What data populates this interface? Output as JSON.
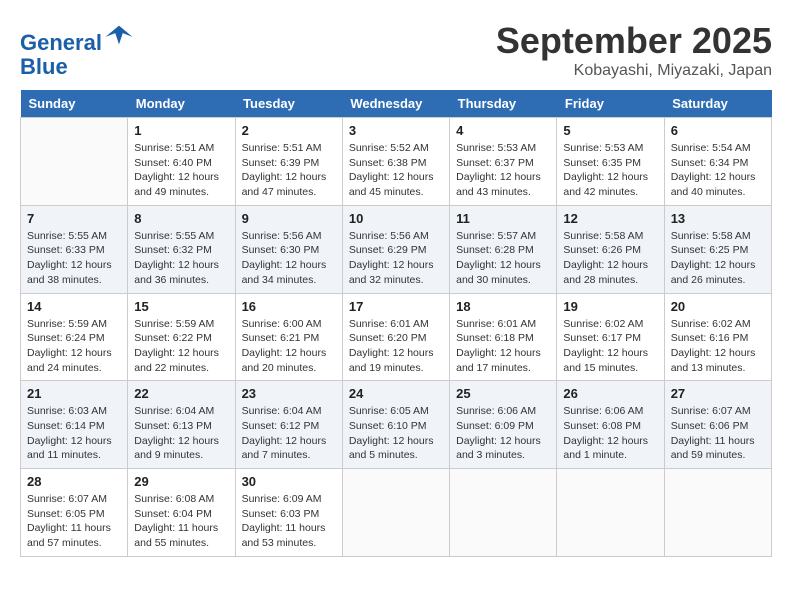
{
  "header": {
    "logo_line1": "General",
    "logo_line2": "Blue",
    "month": "September 2025",
    "location": "Kobayashi, Miyazaki, Japan"
  },
  "weekdays": [
    "Sunday",
    "Monday",
    "Tuesday",
    "Wednesday",
    "Thursday",
    "Friday",
    "Saturday"
  ],
  "weeks": [
    [
      {
        "day": "",
        "info": ""
      },
      {
        "day": "1",
        "info": "Sunrise: 5:51 AM\nSunset: 6:40 PM\nDaylight: 12 hours\nand 49 minutes."
      },
      {
        "day": "2",
        "info": "Sunrise: 5:51 AM\nSunset: 6:39 PM\nDaylight: 12 hours\nand 47 minutes."
      },
      {
        "day": "3",
        "info": "Sunrise: 5:52 AM\nSunset: 6:38 PM\nDaylight: 12 hours\nand 45 minutes."
      },
      {
        "day": "4",
        "info": "Sunrise: 5:53 AM\nSunset: 6:37 PM\nDaylight: 12 hours\nand 43 minutes."
      },
      {
        "day": "5",
        "info": "Sunrise: 5:53 AM\nSunset: 6:35 PM\nDaylight: 12 hours\nand 42 minutes."
      },
      {
        "day": "6",
        "info": "Sunrise: 5:54 AM\nSunset: 6:34 PM\nDaylight: 12 hours\nand 40 minutes."
      }
    ],
    [
      {
        "day": "7",
        "info": "Sunrise: 5:55 AM\nSunset: 6:33 PM\nDaylight: 12 hours\nand 38 minutes."
      },
      {
        "day": "8",
        "info": "Sunrise: 5:55 AM\nSunset: 6:32 PM\nDaylight: 12 hours\nand 36 minutes."
      },
      {
        "day": "9",
        "info": "Sunrise: 5:56 AM\nSunset: 6:30 PM\nDaylight: 12 hours\nand 34 minutes."
      },
      {
        "day": "10",
        "info": "Sunrise: 5:56 AM\nSunset: 6:29 PM\nDaylight: 12 hours\nand 32 minutes."
      },
      {
        "day": "11",
        "info": "Sunrise: 5:57 AM\nSunset: 6:28 PM\nDaylight: 12 hours\nand 30 minutes."
      },
      {
        "day": "12",
        "info": "Sunrise: 5:58 AM\nSunset: 6:26 PM\nDaylight: 12 hours\nand 28 minutes."
      },
      {
        "day": "13",
        "info": "Sunrise: 5:58 AM\nSunset: 6:25 PM\nDaylight: 12 hours\nand 26 minutes."
      }
    ],
    [
      {
        "day": "14",
        "info": "Sunrise: 5:59 AM\nSunset: 6:24 PM\nDaylight: 12 hours\nand 24 minutes."
      },
      {
        "day": "15",
        "info": "Sunrise: 5:59 AM\nSunset: 6:22 PM\nDaylight: 12 hours\nand 22 minutes."
      },
      {
        "day": "16",
        "info": "Sunrise: 6:00 AM\nSunset: 6:21 PM\nDaylight: 12 hours\nand 20 minutes."
      },
      {
        "day": "17",
        "info": "Sunrise: 6:01 AM\nSunset: 6:20 PM\nDaylight: 12 hours\nand 19 minutes."
      },
      {
        "day": "18",
        "info": "Sunrise: 6:01 AM\nSunset: 6:18 PM\nDaylight: 12 hours\nand 17 minutes."
      },
      {
        "day": "19",
        "info": "Sunrise: 6:02 AM\nSunset: 6:17 PM\nDaylight: 12 hours\nand 15 minutes."
      },
      {
        "day": "20",
        "info": "Sunrise: 6:02 AM\nSunset: 6:16 PM\nDaylight: 12 hours\nand 13 minutes."
      }
    ],
    [
      {
        "day": "21",
        "info": "Sunrise: 6:03 AM\nSunset: 6:14 PM\nDaylight: 12 hours\nand 11 minutes."
      },
      {
        "day": "22",
        "info": "Sunrise: 6:04 AM\nSunset: 6:13 PM\nDaylight: 12 hours\nand 9 minutes."
      },
      {
        "day": "23",
        "info": "Sunrise: 6:04 AM\nSunset: 6:12 PM\nDaylight: 12 hours\nand 7 minutes."
      },
      {
        "day": "24",
        "info": "Sunrise: 6:05 AM\nSunset: 6:10 PM\nDaylight: 12 hours\nand 5 minutes."
      },
      {
        "day": "25",
        "info": "Sunrise: 6:06 AM\nSunset: 6:09 PM\nDaylight: 12 hours\nand 3 minutes."
      },
      {
        "day": "26",
        "info": "Sunrise: 6:06 AM\nSunset: 6:08 PM\nDaylight: 12 hours\nand 1 minute."
      },
      {
        "day": "27",
        "info": "Sunrise: 6:07 AM\nSunset: 6:06 PM\nDaylight: 11 hours\nand 59 minutes."
      }
    ],
    [
      {
        "day": "28",
        "info": "Sunrise: 6:07 AM\nSunset: 6:05 PM\nDaylight: 11 hours\nand 57 minutes."
      },
      {
        "day": "29",
        "info": "Sunrise: 6:08 AM\nSunset: 6:04 PM\nDaylight: 11 hours\nand 55 minutes."
      },
      {
        "day": "30",
        "info": "Sunrise: 6:09 AM\nSunset: 6:03 PM\nDaylight: 11 hours\nand 53 minutes."
      },
      {
        "day": "",
        "info": ""
      },
      {
        "day": "",
        "info": ""
      },
      {
        "day": "",
        "info": ""
      },
      {
        "day": "",
        "info": ""
      }
    ]
  ]
}
